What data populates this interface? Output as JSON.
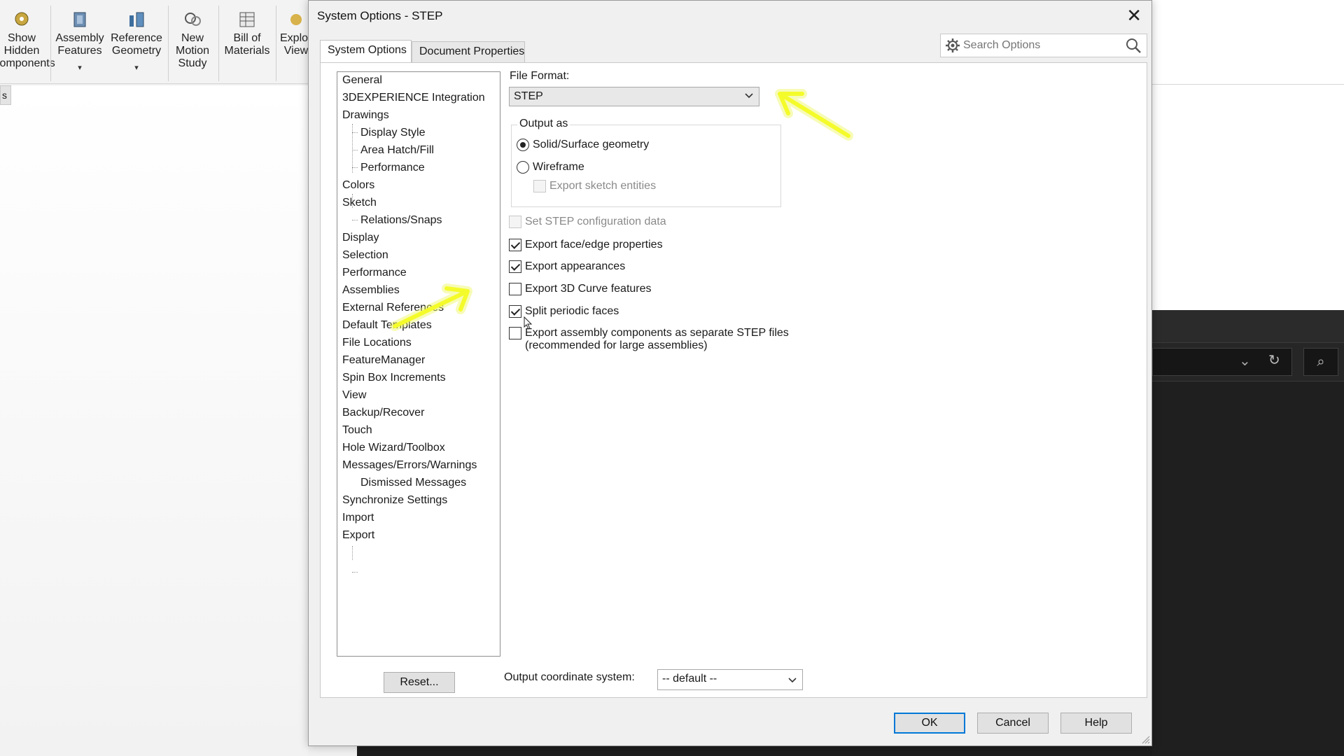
{
  "toolbar": {
    "buttons": [
      {
        "label_l1": "Show",
        "label_l2": "Hidden",
        "label_l3": "Components"
      },
      {
        "label_l1": "Assembly",
        "label_l2": "Features"
      },
      {
        "label_l1": "Reference",
        "label_l2": "Geometry"
      },
      {
        "label_l1": "New",
        "label_l2": "Motion",
        "label_l3": "Study"
      },
      {
        "label_l1": "Bill of",
        "label_l2": "Materials"
      },
      {
        "label_l1": "Exploded",
        "label_l2": "View"
      }
    ],
    "side_tab": "s"
  },
  "dialog": {
    "title": "System Options - STEP",
    "close_icon": "close-icon",
    "tabs": [
      {
        "label": "System Options",
        "active": true
      },
      {
        "label": "Document Properties",
        "active": false
      }
    ],
    "search_placeholder": "Search Options"
  },
  "tree": {
    "items": [
      {
        "label": "General",
        "child": false
      },
      {
        "label": "3DEXPERIENCE Integration",
        "child": false
      },
      {
        "label": "Drawings",
        "child": false
      },
      {
        "label": "Display Style",
        "child": true
      },
      {
        "label": "Area Hatch/Fill",
        "child": true
      },
      {
        "label": "Performance",
        "child": true
      },
      {
        "label": "Colors",
        "child": false
      },
      {
        "label": "Sketch",
        "child": false
      },
      {
        "label": "Relations/Snaps",
        "child": true
      },
      {
        "label": "Display",
        "child": false
      },
      {
        "label": "Selection",
        "child": false
      },
      {
        "label": "Performance",
        "child": false
      },
      {
        "label": "Assemblies",
        "child": false
      },
      {
        "label": "External References",
        "child": false
      },
      {
        "label": "Default Templates",
        "child": false
      },
      {
        "label": "File Locations",
        "child": false
      },
      {
        "label": "FeatureManager",
        "child": false
      },
      {
        "label": "Spin Box Increments",
        "child": false
      },
      {
        "label": "View",
        "child": false
      },
      {
        "label": "Backup/Recover",
        "child": false
      },
      {
        "label": "Touch",
        "child": false
      },
      {
        "label": "Hole Wizard/Toolbox",
        "child": false
      },
      {
        "label": "Messages/Errors/Warnings",
        "child": false
      },
      {
        "label": "Dismissed Messages",
        "child": true
      },
      {
        "label": "Synchronize Settings",
        "child": false
      },
      {
        "label": "Import",
        "child": false
      },
      {
        "label": "Export",
        "child": false
      }
    ],
    "reset_label": "Reset..."
  },
  "export": {
    "file_format_label": "File Format:",
    "file_format_value": "STEP",
    "output_as_legend": "Output as",
    "solid_surface_label": "Solid/Surface geometry",
    "solid_surface_selected": true,
    "wireframe_label": "Wireframe",
    "wireframe_selected": false,
    "export_sketch_label": "Export sketch entities",
    "set_step_config_label": "Set STEP configuration data",
    "export_face_edge_label": "Export face/edge properties",
    "export_face_edge_checked": true,
    "export_appearances_label": "Export appearances",
    "export_appearances_checked": true,
    "export_3d_curve_label": "Export 3D Curve features",
    "export_3d_curve_checked": false,
    "split_periodic_label": "Split periodic faces",
    "split_periodic_checked": true,
    "export_assembly_label_l1": "Export assembly components as separate STEP files",
    "export_assembly_label_l2": "(recommended for large assemblies)",
    "export_assembly_checked": false,
    "output_coord_label": "Output coordinate system:",
    "output_coord_value": "-- default --"
  },
  "footer": {
    "ok": "OK",
    "cancel": "Cancel",
    "help": "Help"
  },
  "colors": {
    "annotation_arrow": "#f4fb2a",
    "default_button_border": "#0078d7"
  }
}
